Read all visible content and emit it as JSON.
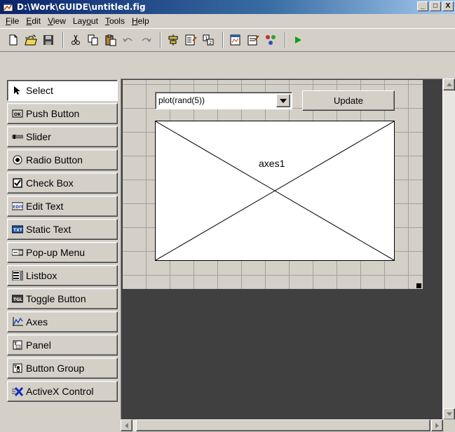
{
  "window": {
    "title": "D:\\Work\\GUIDE\\untitled.fig",
    "minimize": "_",
    "maximize": "□",
    "close": "X"
  },
  "menu": [
    {
      "key": "F",
      "rest": "ile"
    },
    {
      "key": "E",
      "rest": "dit"
    },
    {
      "key": "V",
      "rest": "iew"
    },
    {
      "pre": "Lay",
      "key": "o",
      "rest": "ut"
    },
    {
      "key": "T",
      "rest": "ools"
    },
    {
      "key": "H",
      "rest": "elp"
    }
  ],
  "toolbar": [
    "new-icon",
    "open-icon",
    "save-icon",
    "cut-icon",
    "copy-icon",
    "paste-icon",
    "undo-icon",
    "redo-icon",
    "align-icon",
    "menu-editor-icon",
    "tab-order-icon",
    "mfile-editor-icon",
    "property-inspector-icon",
    "object-browser-icon",
    "run-icon"
  ],
  "palette": [
    {
      "label": "Select",
      "icon": "select-arrow-icon"
    },
    {
      "label": "Push Button",
      "icon": "push-button-icon"
    },
    {
      "label": "Slider",
      "icon": "slider-icon"
    },
    {
      "label": "Radio Button",
      "icon": "radio-button-icon"
    },
    {
      "label": "Check Box",
      "icon": "check-box-icon"
    },
    {
      "label": "Edit Text",
      "icon": "edit-text-icon"
    },
    {
      "label": "Static Text",
      "icon": "static-text-icon"
    },
    {
      "label": "Pop-up Menu",
      "icon": "popup-menu-icon"
    },
    {
      "label": "Listbox",
      "icon": "listbox-icon"
    },
    {
      "label": "Toggle Button",
      "icon": "toggle-button-icon"
    },
    {
      "label": "Axes",
      "icon": "axes-icon"
    },
    {
      "label": "Panel",
      "icon": "panel-icon"
    },
    {
      "label": "Button Group",
      "icon": "button-group-icon"
    },
    {
      "label": "ActiveX Control",
      "icon": "activex-icon"
    }
  ],
  "layout": {
    "popup_value": "plot(rand(5))",
    "update_label": "Update",
    "axes_label": "axes1"
  }
}
